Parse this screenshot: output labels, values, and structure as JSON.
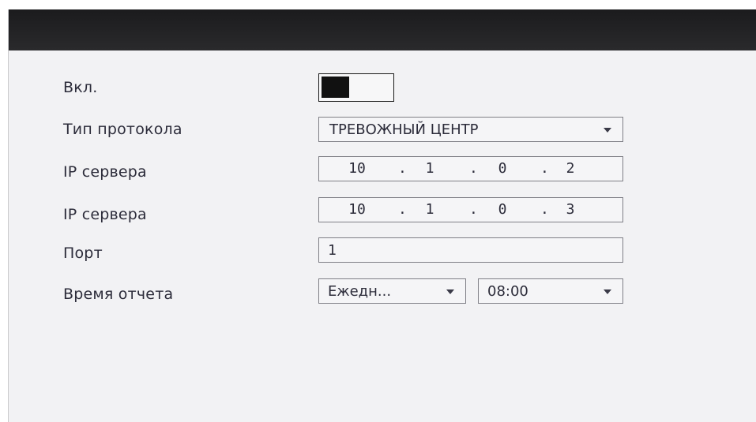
{
  "form": {
    "enable": {
      "label": "Вкл.",
      "value": "on"
    },
    "protocol": {
      "label": "Тип протокола",
      "value": "ТРЕВОЖНЫЙ ЦЕНТР"
    },
    "server_ip_1": {
      "label": "IP сервера",
      "octets": [
        "10",
        "1",
        "0",
        "2"
      ],
      "sep": "."
    },
    "server_ip_2": {
      "label": "IP сервера",
      "octets": [
        "10",
        "1",
        "0",
        "3"
      ],
      "sep": "."
    },
    "port": {
      "label": "Порт",
      "value": "1"
    },
    "report_time": {
      "label": "Время отчета",
      "frequency": "Ежедн...",
      "time": "08:00"
    }
  },
  "colors": {
    "background": "#f2f2f4",
    "topbar": "#1b1b1d",
    "text": "#2c2c3a",
    "border": "#7f7f86"
  }
}
